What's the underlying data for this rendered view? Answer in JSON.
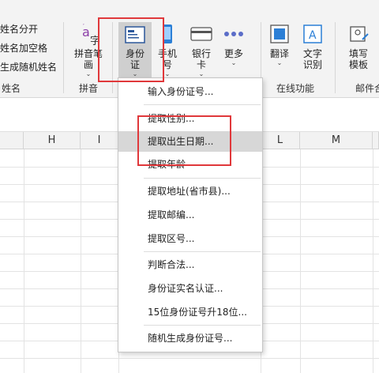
{
  "ribbon": {
    "name_group": {
      "items": [
        "姓名分开",
        "姓名加空格",
        "生成随机姓名"
      ],
      "group_label": "姓名"
    },
    "pinyin_group": {
      "button_label_1": "拼音笔",
      "button_label_2": "画",
      "group_label": "拼音"
    },
    "buttons": {
      "id_card": [
        "身份",
        "证"
      ],
      "phone": [
        "手机",
        "号"
      ],
      "bank_card": [
        "银行",
        "卡"
      ],
      "more": [
        "更多"
      ],
      "translate": [
        "翻译"
      ],
      "text_recognition": [
        "文字",
        "识别"
      ],
      "fill_template": [
        "填写",
        "模板"
      ]
    },
    "online_group_label": "在线功能",
    "mail_group_label": "邮件合"
  },
  "columns": [
    "H",
    "I",
    "L",
    "M"
  ],
  "menu": {
    "items": [
      "输入身份证号...",
      "提取性别...",
      "提取出生日期...",
      "提取年龄",
      "提取地址(省市县)...",
      "提取邮编...",
      "提取区号...",
      "判断合法...",
      "身份证实名认证...",
      "15位身份证号升18位...",
      "随机生成身份证号..."
    ]
  },
  "colors": {
    "highlight_box": "#e0383b",
    "menu_hover": "#d7d7d7",
    "ribbon_bg": "#f3f3f3"
  }
}
